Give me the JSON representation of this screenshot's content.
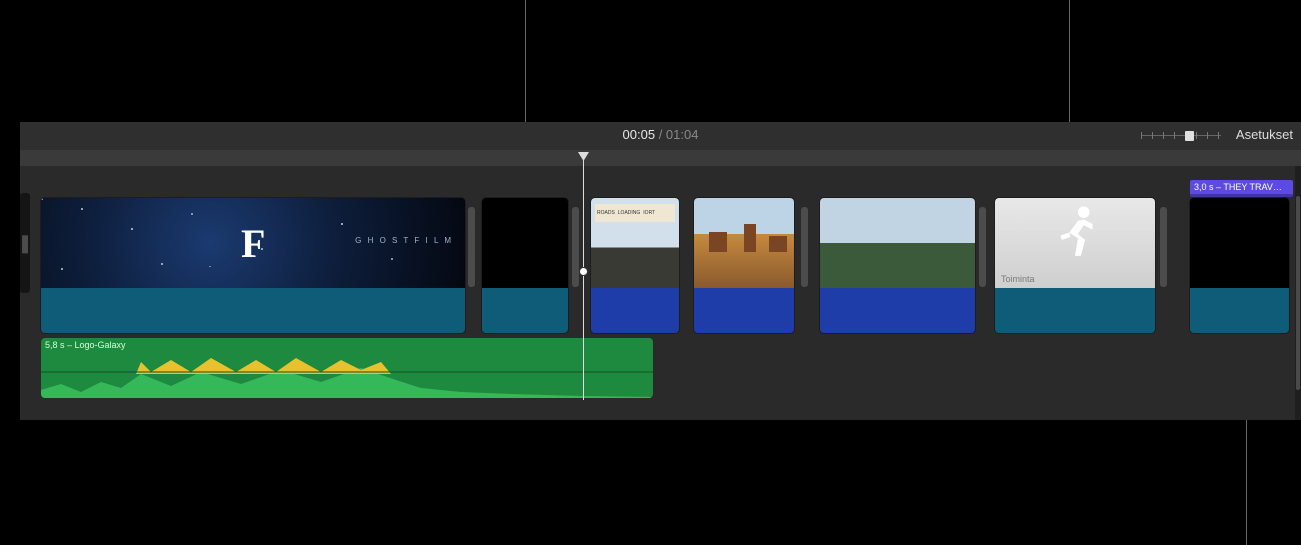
{
  "timecode": {
    "current": "00:05",
    "total": "01:04"
  },
  "settings_label": "Asetukset",
  "title_chip": {
    "text": "3,0 s – THEY TRAV…"
  },
  "music": {
    "label": "5,8 s – Logo-Galaxy"
  },
  "clips": {
    "galaxy": {
      "letter": "F",
      "studio": "G H O S T   F I L M"
    },
    "sign": {
      "words": [
        "ROADS",
        "LOADING",
        "IORT"
      ]
    },
    "activity": {
      "label": "Toiminta"
    }
  }
}
